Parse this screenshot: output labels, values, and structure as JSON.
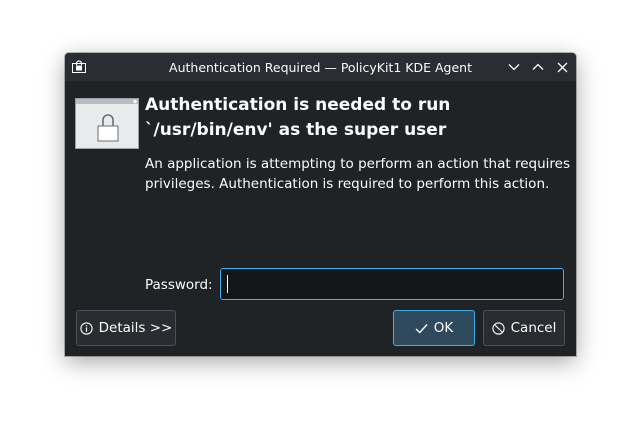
{
  "window": {
    "title": "Authentication Required — PolicyKit1 KDE Agent"
  },
  "message": {
    "heading": "Authentication is needed to run `/usr/bin/env' as the super user",
    "description": "An application is attempting to perform an action that requires privileges. Authentication is required to perform this action."
  },
  "password": {
    "label": "Password:",
    "value": "",
    "placeholder": ""
  },
  "buttons": {
    "details_label": "Details >>",
    "ok_label": "OK",
    "cancel_label": "Cancel"
  },
  "colors": {
    "window_bg": "#202326",
    "titlebar_bg": "#2a2e32",
    "accent": "#3daee9",
    "text": "#fcfcfc"
  },
  "icons": {
    "title": "lock-icon",
    "minimize": "chevron-down-icon",
    "maximize": "chevron-up-icon",
    "close": "close-icon",
    "dialog": "lock-icon",
    "details": "info-icon",
    "ok": "checkmark-icon",
    "cancel": "cancel-icon"
  }
}
